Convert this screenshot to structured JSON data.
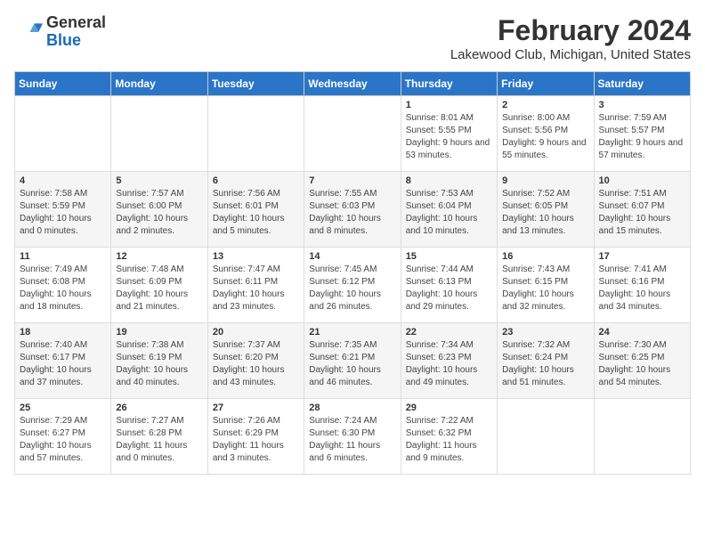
{
  "header": {
    "logo_general": "General",
    "logo_blue": "Blue",
    "title": "February 2024",
    "subtitle": "Lakewood Club, Michigan, United States"
  },
  "calendar": {
    "headers": [
      "Sunday",
      "Monday",
      "Tuesday",
      "Wednesday",
      "Thursday",
      "Friday",
      "Saturday"
    ],
    "weeks": [
      [
        {
          "day": "",
          "sunrise": "",
          "sunset": "",
          "daylight": "",
          "empty": true
        },
        {
          "day": "",
          "sunrise": "",
          "sunset": "",
          "daylight": "",
          "empty": true
        },
        {
          "day": "",
          "sunrise": "",
          "sunset": "",
          "daylight": "",
          "empty": true
        },
        {
          "day": "",
          "sunrise": "",
          "sunset": "",
          "daylight": "",
          "empty": true
        },
        {
          "day": "1",
          "sunrise": "Sunrise: 8:01 AM",
          "sunset": "Sunset: 5:55 PM",
          "daylight": "Daylight: 9 hours and 53 minutes.",
          "empty": false
        },
        {
          "day": "2",
          "sunrise": "Sunrise: 8:00 AM",
          "sunset": "Sunset: 5:56 PM",
          "daylight": "Daylight: 9 hours and 55 minutes.",
          "empty": false
        },
        {
          "day": "3",
          "sunrise": "Sunrise: 7:59 AM",
          "sunset": "Sunset: 5:57 PM",
          "daylight": "Daylight: 9 hours and 57 minutes.",
          "empty": false
        }
      ],
      [
        {
          "day": "4",
          "sunrise": "Sunrise: 7:58 AM",
          "sunset": "Sunset: 5:59 PM",
          "daylight": "Daylight: 10 hours and 0 minutes.",
          "empty": false
        },
        {
          "day": "5",
          "sunrise": "Sunrise: 7:57 AM",
          "sunset": "Sunset: 6:00 PM",
          "daylight": "Daylight: 10 hours and 2 minutes.",
          "empty": false
        },
        {
          "day": "6",
          "sunrise": "Sunrise: 7:56 AM",
          "sunset": "Sunset: 6:01 PM",
          "daylight": "Daylight: 10 hours and 5 minutes.",
          "empty": false
        },
        {
          "day": "7",
          "sunrise": "Sunrise: 7:55 AM",
          "sunset": "Sunset: 6:03 PM",
          "daylight": "Daylight: 10 hours and 8 minutes.",
          "empty": false
        },
        {
          "day": "8",
          "sunrise": "Sunrise: 7:53 AM",
          "sunset": "Sunset: 6:04 PM",
          "daylight": "Daylight: 10 hours and 10 minutes.",
          "empty": false
        },
        {
          "day": "9",
          "sunrise": "Sunrise: 7:52 AM",
          "sunset": "Sunset: 6:05 PM",
          "daylight": "Daylight: 10 hours and 13 minutes.",
          "empty": false
        },
        {
          "day": "10",
          "sunrise": "Sunrise: 7:51 AM",
          "sunset": "Sunset: 6:07 PM",
          "daylight": "Daylight: 10 hours and 15 minutes.",
          "empty": false
        }
      ],
      [
        {
          "day": "11",
          "sunrise": "Sunrise: 7:49 AM",
          "sunset": "Sunset: 6:08 PM",
          "daylight": "Daylight: 10 hours and 18 minutes.",
          "empty": false
        },
        {
          "day": "12",
          "sunrise": "Sunrise: 7:48 AM",
          "sunset": "Sunset: 6:09 PM",
          "daylight": "Daylight: 10 hours and 21 minutes.",
          "empty": false
        },
        {
          "day": "13",
          "sunrise": "Sunrise: 7:47 AM",
          "sunset": "Sunset: 6:11 PM",
          "daylight": "Daylight: 10 hours and 23 minutes.",
          "empty": false
        },
        {
          "day": "14",
          "sunrise": "Sunrise: 7:45 AM",
          "sunset": "Sunset: 6:12 PM",
          "daylight": "Daylight: 10 hours and 26 minutes.",
          "empty": false
        },
        {
          "day": "15",
          "sunrise": "Sunrise: 7:44 AM",
          "sunset": "Sunset: 6:13 PM",
          "daylight": "Daylight: 10 hours and 29 minutes.",
          "empty": false
        },
        {
          "day": "16",
          "sunrise": "Sunrise: 7:43 AM",
          "sunset": "Sunset: 6:15 PM",
          "daylight": "Daylight: 10 hours and 32 minutes.",
          "empty": false
        },
        {
          "day": "17",
          "sunrise": "Sunrise: 7:41 AM",
          "sunset": "Sunset: 6:16 PM",
          "daylight": "Daylight: 10 hours and 34 minutes.",
          "empty": false
        }
      ],
      [
        {
          "day": "18",
          "sunrise": "Sunrise: 7:40 AM",
          "sunset": "Sunset: 6:17 PM",
          "daylight": "Daylight: 10 hours and 37 minutes.",
          "empty": false
        },
        {
          "day": "19",
          "sunrise": "Sunrise: 7:38 AM",
          "sunset": "Sunset: 6:19 PM",
          "daylight": "Daylight: 10 hours and 40 minutes.",
          "empty": false
        },
        {
          "day": "20",
          "sunrise": "Sunrise: 7:37 AM",
          "sunset": "Sunset: 6:20 PM",
          "daylight": "Daylight: 10 hours and 43 minutes.",
          "empty": false
        },
        {
          "day": "21",
          "sunrise": "Sunrise: 7:35 AM",
          "sunset": "Sunset: 6:21 PM",
          "daylight": "Daylight: 10 hours and 46 minutes.",
          "empty": false
        },
        {
          "day": "22",
          "sunrise": "Sunrise: 7:34 AM",
          "sunset": "Sunset: 6:23 PM",
          "daylight": "Daylight: 10 hours and 49 minutes.",
          "empty": false
        },
        {
          "day": "23",
          "sunrise": "Sunrise: 7:32 AM",
          "sunset": "Sunset: 6:24 PM",
          "daylight": "Daylight: 10 hours and 51 minutes.",
          "empty": false
        },
        {
          "day": "24",
          "sunrise": "Sunrise: 7:30 AM",
          "sunset": "Sunset: 6:25 PM",
          "daylight": "Daylight: 10 hours and 54 minutes.",
          "empty": false
        }
      ],
      [
        {
          "day": "25",
          "sunrise": "Sunrise: 7:29 AM",
          "sunset": "Sunset: 6:27 PM",
          "daylight": "Daylight: 10 hours and 57 minutes.",
          "empty": false
        },
        {
          "day": "26",
          "sunrise": "Sunrise: 7:27 AM",
          "sunset": "Sunset: 6:28 PM",
          "daylight": "Daylight: 11 hours and 0 minutes.",
          "empty": false
        },
        {
          "day": "27",
          "sunrise": "Sunrise: 7:26 AM",
          "sunset": "Sunset: 6:29 PM",
          "daylight": "Daylight: 11 hours and 3 minutes.",
          "empty": false
        },
        {
          "day": "28",
          "sunrise": "Sunrise: 7:24 AM",
          "sunset": "Sunset: 6:30 PM",
          "daylight": "Daylight: 11 hours and 6 minutes.",
          "empty": false
        },
        {
          "day": "29",
          "sunrise": "Sunrise: 7:22 AM",
          "sunset": "Sunset: 6:32 PM",
          "daylight": "Daylight: 11 hours and 9 minutes.",
          "empty": false
        },
        {
          "day": "",
          "sunrise": "",
          "sunset": "",
          "daylight": "",
          "empty": true
        },
        {
          "day": "",
          "sunrise": "",
          "sunset": "",
          "daylight": "",
          "empty": true
        }
      ]
    ]
  }
}
